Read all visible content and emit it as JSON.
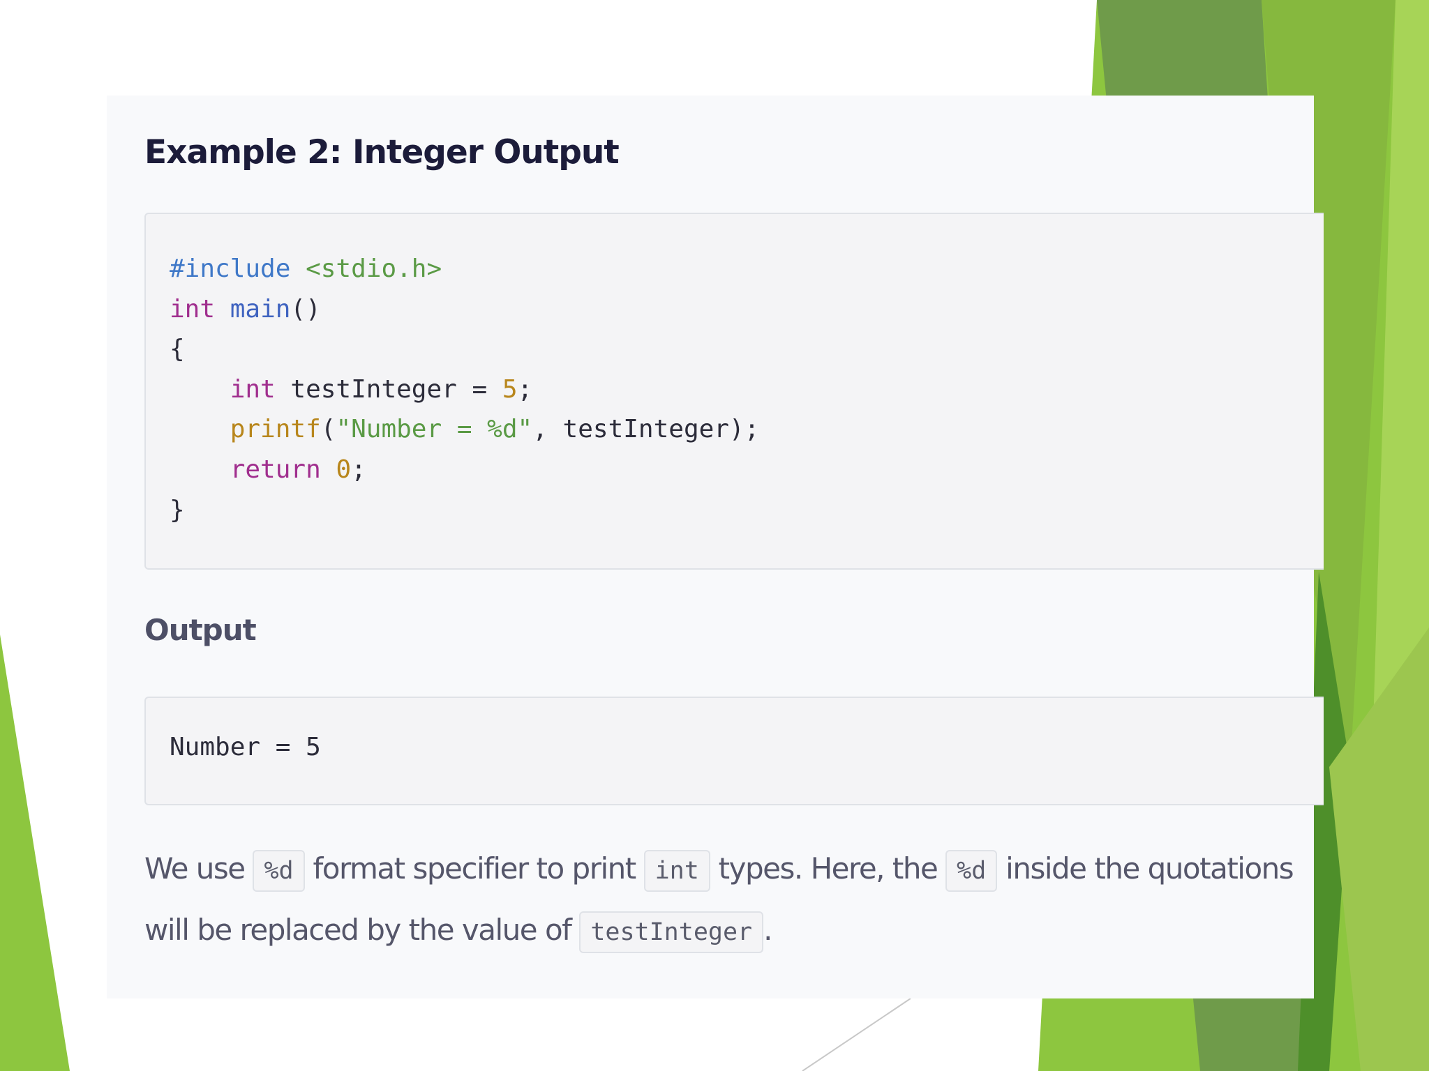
{
  "example": {
    "heading": "Example 2: Integer Output",
    "code_lines": [
      [
        {
          "t": "#include ",
          "c": "kw-pre"
        },
        {
          "t": "<stdio.h>",
          "c": "str"
        }
      ],
      [
        {
          "t": "int",
          "c": "kw"
        },
        {
          "t": " ",
          "c": ""
        },
        {
          "t": "main",
          "c": "fn"
        },
        {
          "t": "()",
          "c": ""
        }
      ],
      [
        {
          "t": "{",
          "c": ""
        }
      ],
      [
        {
          "t": "    ",
          "c": ""
        },
        {
          "t": "int",
          "c": "kw"
        },
        {
          "t": " testInteger = ",
          "c": ""
        },
        {
          "t": "5",
          "c": "num"
        },
        {
          "t": ";",
          "c": ""
        }
      ],
      [
        {
          "t": "    ",
          "c": ""
        },
        {
          "t": "printf",
          "c": "fn2"
        },
        {
          "t": "(",
          "c": ""
        },
        {
          "t": "\"Number = %d\"",
          "c": "str"
        },
        {
          "t": ", testInteger);",
          "c": ""
        }
      ],
      [
        {
          "t": "    ",
          "c": ""
        },
        {
          "t": "return",
          "c": "kw"
        },
        {
          "t": " ",
          "c": ""
        },
        {
          "t": "0",
          "c": "num"
        },
        {
          "t": ";",
          "c": ""
        }
      ],
      [
        {
          "t": "}",
          "c": ""
        }
      ]
    ],
    "output_heading": "Output",
    "output_text": "Number = 5",
    "explanation": {
      "t1": "We use",
      "c1": "%d",
      "t2": "format specifier to print",
      "c2": "int",
      "t3": "types. Here, the",
      "c3": "%d",
      "t4": "inside the quotations will be replaced by the value of",
      "c4": "testInteger",
      "t5": "."
    }
  },
  "colors": {
    "accent_green": "#8dc63f",
    "dark_green": "#4e8f2a",
    "olive_green": "#6f9b4a",
    "heading": "#1c1c3a",
    "keyword": "#a02e8e",
    "string": "#5a9a45",
    "number": "#b8861c",
    "preprocessor": "#3f78c8"
  }
}
